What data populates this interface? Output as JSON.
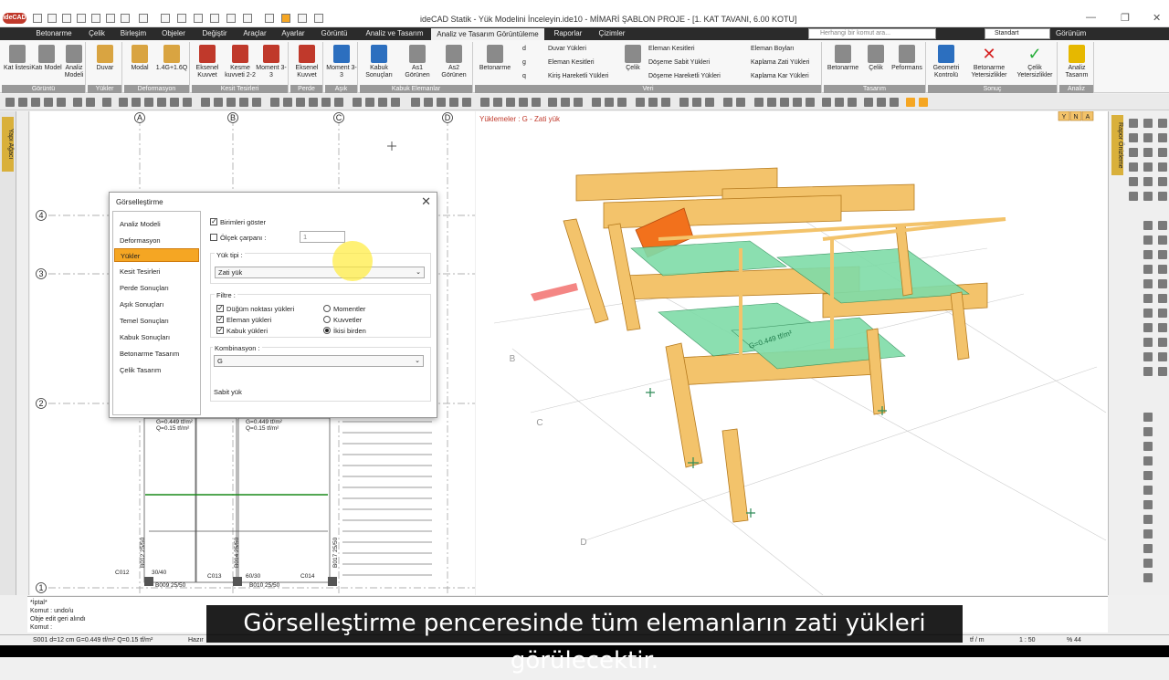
{
  "window": {
    "title": "ideCAD Statik - Yük Modelini İnceleyin.ide10 - MİMARİ ŞABLON PROJE - [1. KAT TAVANI,  6.00 KOTU]",
    "logo": "ideCAD"
  },
  "menu": {
    "tabs": [
      "Betonarme",
      "Çelik",
      "Birleşim",
      "Objeler",
      "Değiştir",
      "Araçlar",
      "Ayarlar",
      "Görüntü",
      "Analiz ve Tasarım",
      "Analiz ve Tasarım Görüntüleme",
      "Raporlar",
      "Çizimler"
    ],
    "active_tab": "Analiz ve Tasarım Görüntüleme",
    "search_placeholder": "Herhangi bir komut ara...",
    "style_select": "Standart",
    "view_label": "Görünüm"
  },
  "ribbon": {
    "groups": {
      "gorunum": "Görüntü",
      "yukler": "Yükler",
      "deformasyon": "Deformasyon",
      "kesit": "Kesit Tesirleri",
      "perde": "Perde",
      "asik": "Aşık",
      "kabuk": "Kabuk Elemanlar",
      "veri": "Veri",
      "tasarim": "Tasarım",
      "sonuc": "Sonuç",
      "analiz": "Analiz"
    },
    "buttons": {
      "kat_listesi": "Kat listesi",
      "kati_model": "Katı Model",
      "analiz_modeli": "Analiz Modeli",
      "duvar": "Duvar",
      "modal": "Modal",
      "comb": "1.4G+1.6Q",
      "eksenel_kuvvet": "Eksenel Kuvvet",
      "kesme_kuvveti": "Kesme kuvveti 2-2",
      "moment": "Moment 3-3",
      "perde_eksenel": "Eksenel Kuvvet",
      "asik_moment": "Moment 3-3",
      "kabuk_sonuclari": "Kabuk Sonuçları",
      "as1": "As1 Görünen",
      "as2": "As2 Görünen",
      "betonarme": "Betonarme",
      "celik": "Çelik",
      "t_betonarme": "Betonarme",
      "t_celik": "Çelik",
      "performans": "Peformans",
      "geometri": "Geometri Kontrolü",
      "betonarme_yeter": "Betonarme Yetersizlikler",
      "celik_yeter": "Çelik Yetersizlikler",
      "analiz_tasarim": "Analiz Tasarım"
    },
    "small": {
      "duvar_yukleri": "Duvar Yükleri",
      "eleman_kesitleri": "Eleman Kesitleri",
      "kiris_hareketli": "Kiriş Hareketli Yükleri",
      "eleman_kesitleri2": "Eleman Kesitleri",
      "doseme_sabit": "Döşeme Sabit Yükleri",
      "doseme_hareketli": "Döşeme Hareketli Yükleri",
      "eleman_boylari": "Eleman Boyları",
      "kaplama_zati": "Kaplama Zati  Yükleri",
      "kaplama_kar": "Kaplama Kar Yükleri",
      "d": "d",
      "g": "g",
      "q": "q"
    }
  },
  "side_panels": {
    "left_tab": "Yapı Ağacı",
    "right_tab": "Rapor Önizleme"
  },
  "plan": {
    "axes_top": [
      "A",
      "B",
      "C",
      "D"
    ],
    "axes_left": [
      "4",
      "3",
      "2",
      "1"
    ],
    "slab_labels": [
      {
        "g": "G=0.449 tf/m²",
        "q": "Q=0.15 tf/m²"
      },
      {
        "g": "G=0.449 tf/m²",
        "q": "Q=0.15 tf/m²"
      }
    ],
    "beam_labels": [
      "B009 25/50",
      "B010 25/50",
      "B012 25/50",
      "B014 25/50",
      "B017 25/50"
    ],
    "column_labels": [
      "C012",
      "C013",
      "C014"
    ],
    "dim_label": "30/40",
    "dim_label2": "60/30"
  },
  "view3d": {
    "label": "Yüklemeler : G - Zati yük",
    "corner_labels": [
      "Y",
      "N",
      "A"
    ],
    "floor_text": "G=0.449 tf/m²",
    "axis_labels": [
      "B",
      "C",
      "D"
    ]
  },
  "dialog": {
    "title": "Görselleştirme",
    "nav": [
      "Analiz Modeli",
      "Deformasyon",
      "Yükler",
      "Kesit Tesirleri",
      "Perde Sonuçları",
      "Aşık Sonuçları",
      "Temel Sonuçları",
      "Kabuk Sonuçları",
      "Betonarme Tasarım",
      "Çelik Tasarım"
    ],
    "active_nav": "Yükler",
    "birimleri_goster": "Birimleri göster",
    "olcek_carpani": "Ölçek çarpanı :",
    "olcek_value": "1",
    "yuk_tipi_label": "Yük tipi :",
    "yuk_tipi_value": "Zati yük",
    "filtre_label": "Filtre :",
    "filters": [
      "Düğüm noktası yükleri",
      "Eleman yükleri",
      "Kabuk yükleri"
    ],
    "radios": [
      "Momentler",
      "Kuvvetler",
      "İkisi birden"
    ],
    "kombinasyon_label": "Kombinasyon :",
    "kombinasyon_value": "G",
    "sabit_yuk": "Sabit yük"
  },
  "command": {
    "lines": [
      "*İptal*",
      "Komut : undo/u",
      "Obje edit geri alındı",
      "Komut :"
    ]
  },
  "status": {
    "info": "S001 d=12 cm G=0.449 tf/m² Q=0.15 tf/m²",
    "ready": "Hazır",
    "unit": "tf / m",
    "scale": "1 : 50",
    "zoom": "% 44"
  },
  "subtitle": "Görselleştirme penceresinde tüm elemanların zati yükleri görülecektir.",
  "colors": {
    "member": "#f3c36b",
    "member_edge": "#b57a1e",
    "slab": "#7fdca8",
    "accent": "#f5a623",
    "highlight_beam": "#f2711c"
  }
}
